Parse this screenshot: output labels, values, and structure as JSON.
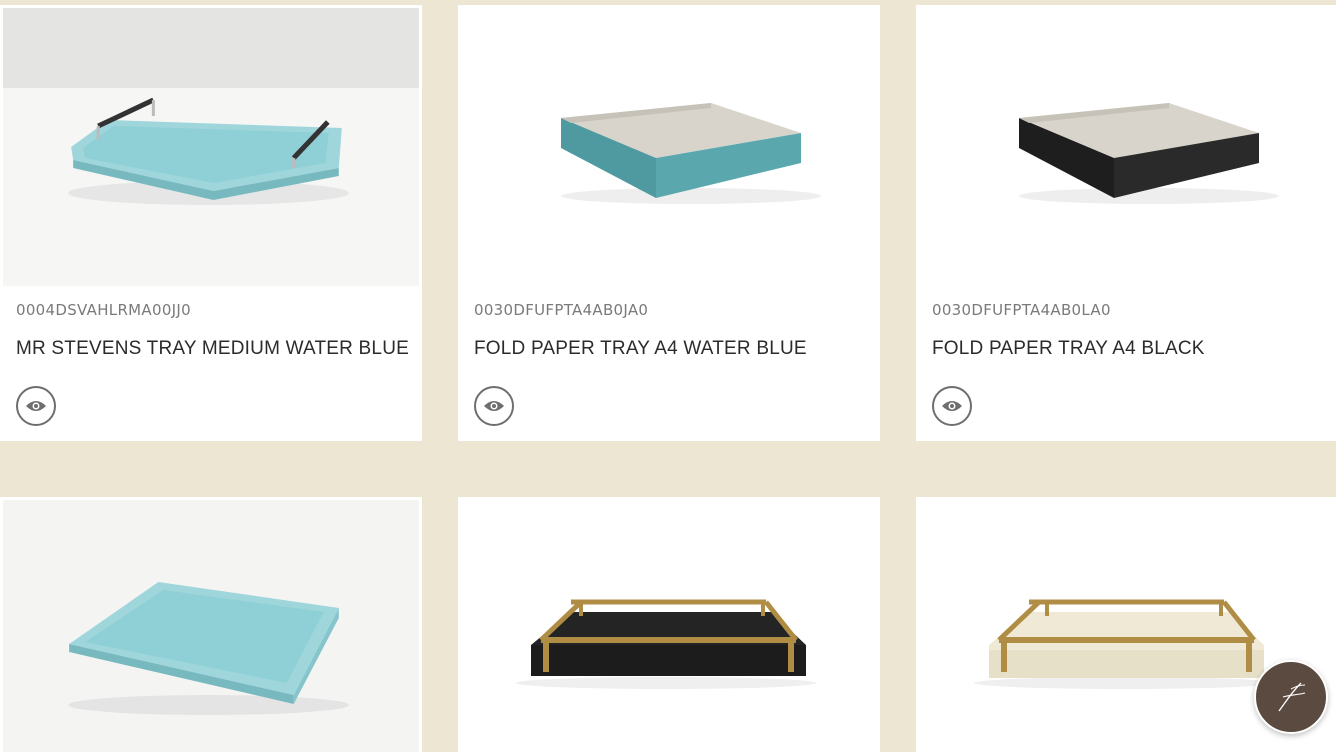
{
  "products": [
    {
      "sku": "0004DSVAHLRMA00JJ0",
      "title": "MR STEVENS TRAY MEDIUM WATER BLUE",
      "image_icon": "tray-with-handles-water-blue"
    },
    {
      "sku": "0030DFUFPTA4AB0JA0",
      "title": "FOLD PAPER TRAY A4 WATER BLUE",
      "image_icon": "paper-tray-water-blue"
    },
    {
      "sku": "0030DFUFPTA4AB0LA0",
      "title": "FOLD PAPER TRAY A4 BLACK",
      "image_icon": "paper-tray-black"
    },
    {
      "image_icon": "tray-water-blue"
    },
    {
      "image_icon": "tray-brass-rails-black"
    },
    {
      "image_icon": "tray-brass-rails-cream"
    }
  ],
  "quick_view_icon": "eye-icon",
  "chat_button_icon": "signature-logo-icon",
  "colors": {
    "page_background": "#ede6d2",
    "card_background": "#ffffff",
    "water_blue": "#8fcfd6",
    "teal": "#4e9aa0",
    "black": "#1e1e1e",
    "brass": "#b08d45",
    "cream": "#efe9d6",
    "chat_brown": "#5b4a40"
  }
}
